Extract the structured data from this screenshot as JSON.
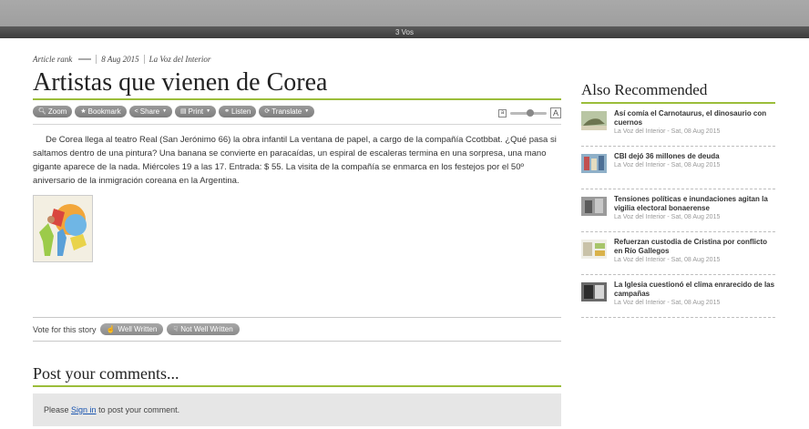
{
  "topbar": {
    "label": "3 Vos"
  },
  "article": {
    "meta": {
      "rank_label": "Article rank",
      "date": "8 Aug 2015",
      "source": "La Voz del Interior"
    },
    "title": "Artistas que vienen de Corea",
    "toolbar": {
      "zoom": "Zoom",
      "bookmark": "Bookmark",
      "share": "Share",
      "print": "Print",
      "listen": "Listen",
      "translate": "Translate",
      "text_small": "a",
      "text_large": "A"
    },
    "body": "De Corea llega al teatro Real (San Jerónimo 66) la obra infantil La ventana de papel, a cargo de la compañía Ccotbbat. ¿Qué pasa si saltamos dentro de una pintura? Una banana se convierte en paracaídas, un espiral de escaleras termina en una sorpresa, una mano gigante aparece de la nada. Miércoles 19 a las 17. Entrada: $ 55. La visita de la compañía se enmarca en los festejos por el 50º aniversario de la inmigración coreana en la Argentina."
  },
  "vote": {
    "label": "Vote for this story",
    "well_written": "Well Written",
    "not_well_written": "Not Well Written"
  },
  "comments": {
    "title": "Post your comments...",
    "prefix": "Please ",
    "link": "Sign in",
    "suffix": " to post your comment."
  },
  "sidebar": {
    "title": "Also Recommended",
    "items": [
      {
        "title": "Así comía el Carnotaurus, el dinosaurio con cuernos",
        "source": "La Voz del Interior - Sat, 08 Aug 2015"
      },
      {
        "title": "CBI dejó 36 millones de deuda",
        "source": "La Voz del Interior - Sat, 08 Aug 2015"
      },
      {
        "title": "Tensiones políticas e inundaciones agitan la vigilia electoral bonaerense",
        "source": "La Voz del Interior - Sat, 08 Aug 2015"
      },
      {
        "title": "Refuerzan custodia de Cristina por conflicto en Río Gallegos",
        "source": "La Voz del Interior - Sat, 08 Aug 2015"
      },
      {
        "title": "La Iglesia cuestionó el clima enrarecido de las campañas",
        "source": "La Voz del Interior - Sat, 08 Aug 2015"
      }
    ]
  },
  "colors": {
    "accent_green": "#9bbd3a",
    "button_gray": "#8a8a8a",
    "link_blue": "#1a55b0"
  }
}
